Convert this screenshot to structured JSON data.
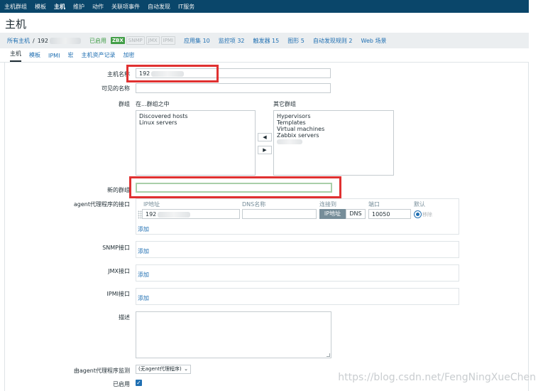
{
  "topnav": [
    "主机群组",
    "模板",
    "主机",
    "维护",
    "动作",
    "关联项事件",
    "自动发现",
    "IT服务"
  ],
  "page_title": "主机",
  "breadcrumb": {
    "all_hosts": "所有主机",
    "sep": "/",
    "host": "192",
    "enabled": "已启用",
    "badges": [
      "ZBX",
      "SNMP",
      "JMX",
      "IPMI"
    ],
    "links": [
      "应用集 10",
      "监控项 32",
      "触发器 15",
      "图形 5",
      "自动发现规则 2",
      "Web 场景"
    ]
  },
  "tabs": [
    "主机",
    "模板",
    "IPMI",
    "宏",
    "主机资产记录",
    "加密"
  ],
  "form": {
    "hostname_label": "主机名称",
    "hostname_value": "192",
    "visible_name_label": "可见的名称",
    "groups_label": "群组",
    "in_groups_label": "在...群组之中",
    "other_groups_label": "其它群组",
    "in_groups": [
      "Discovered hosts",
      "Linux servers"
    ],
    "other_groups": [
      "Hypervisors",
      "Templates",
      "Virtual machines",
      "Zabbix servers"
    ],
    "move_left": "◀",
    "move_right": "▶",
    "new_group_label": "新的群组",
    "agent_label": "agent代理程序的接口",
    "col_ip": "IP地址",
    "col_dns": "DNS名称",
    "col_connect": "连接到",
    "col_port": "端口",
    "col_default": "默认",
    "ip_value": "192",
    "btn_ip": "IP地址",
    "btn_dns": "DNS",
    "port_value": "10050",
    "remove": "移除",
    "add": "添加",
    "snmp_label": "SNMP接口",
    "jmx_label": "JMX接口",
    "ipmi_label": "IPMI接口",
    "description_label": "描述",
    "proxy_label": "由agent代理程序监测",
    "proxy_value": "(无agent代理程序)",
    "enabled_label": "已启用"
  },
  "watermark": "https://blog.csdn.net/FengNingXueChen",
  "colors": {
    "topnav": "#0a466a",
    "link": "#1f6fb2",
    "enabled": "#429e47",
    "highlight": "#e03131"
  }
}
